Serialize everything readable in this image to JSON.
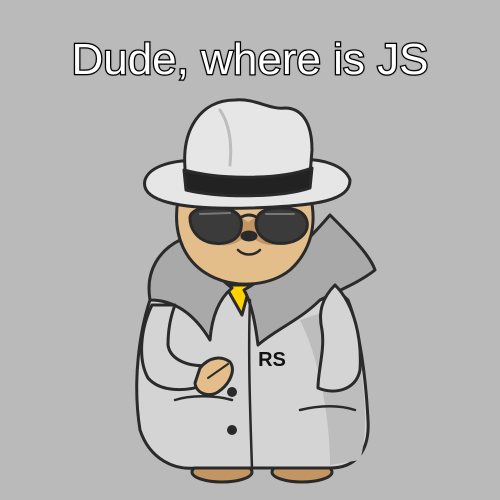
{
  "meme": {
    "caption": "Dude, where is JS",
    "coat_label": "RS"
  },
  "colors": {
    "background": "#bababa",
    "hat": "#e6e6e6",
    "hat_band": "#222222",
    "coat": "#d4d4d4",
    "coat_shadow": "#a9a9a9",
    "fur": "#e3bd8a",
    "fur_dark": "#c29563",
    "glasses": "#3b3b3b",
    "shirt": "#ffd200",
    "outline": "#2a2a2a"
  },
  "icons": {
    "character": "sloth-detective-icon"
  }
}
